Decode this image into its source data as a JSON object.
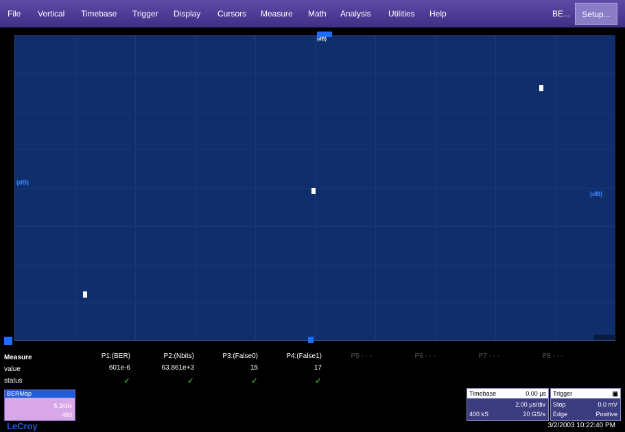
{
  "menu": {
    "items": [
      "File",
      "Vertical",
      "Timebase",
      "Trigger",
      "Display",
      "Cursors",
      "Measure",
      "Math",
      "Analysis",
      "Utilities",
      "Help",
      "BE..."
    ],
    "setup_label": "Setup..."
  },
  "grid": {
    "top_marker": "(dB)",
    "left_marker": "(dB)",
    "right_marker": "(dB)",
    "points": [
      {
        "label": "point-a"
      },
      {
        "label": "point-b"
      },
      {
        "label": "point-c"
      }
    ]
  },
  "measure": {
    "title": "Measure",
    "row_value": "value",
    "row_status": "status",
    "params": [
      {
        "name": "P1:(BER)",
        "value": "601e-6",
        "status": "✓"
      },
      {
        "name": "P2:(Nbits)",
        "value": "63.861e+3",
        "status": "✓"
      },
      {
        "name": "P3:(False0)",
        "value": "15",
        "status": "✓"
      },
      {
        "name": "P4:(False1)",
        "value": "17",
        "status": "✓"
      },
      {
        "name": "P5 - - -",
        "value": "",
        "status": ""
      },
      {
        "name": "P6 - - -",
        "value": "",
        "status": ""
      },
      {
        "name": "P7 - - -",
        "value": "",
        "status": ""
      },
      {
        "name": "P8 - - -",
        "value": "",
        "status": ""
      }
    ]
  },
  "channel": {
    "title": "BERMap",
    "line1": "5.3/div",
    "line2": "450"
  },
  "brand": "LeCroy",
  "timebase": {
    "title": "Timebase",
    "offset": "0.00 µs",
    "div": "2.00 µs/div",
    "samples": "400 kS",
    "rate": "20 GS/s"
  },
  "trigger": {
    "title": "Trigger",
    "icon": "trigger-icon",
    "mode": "Stop",
    "level": "0.0 mV",
    "type": "Edge",
    "slope": "Positive"
  },
  "datetime": "3/2/2003 10:22:40 PM"
}
